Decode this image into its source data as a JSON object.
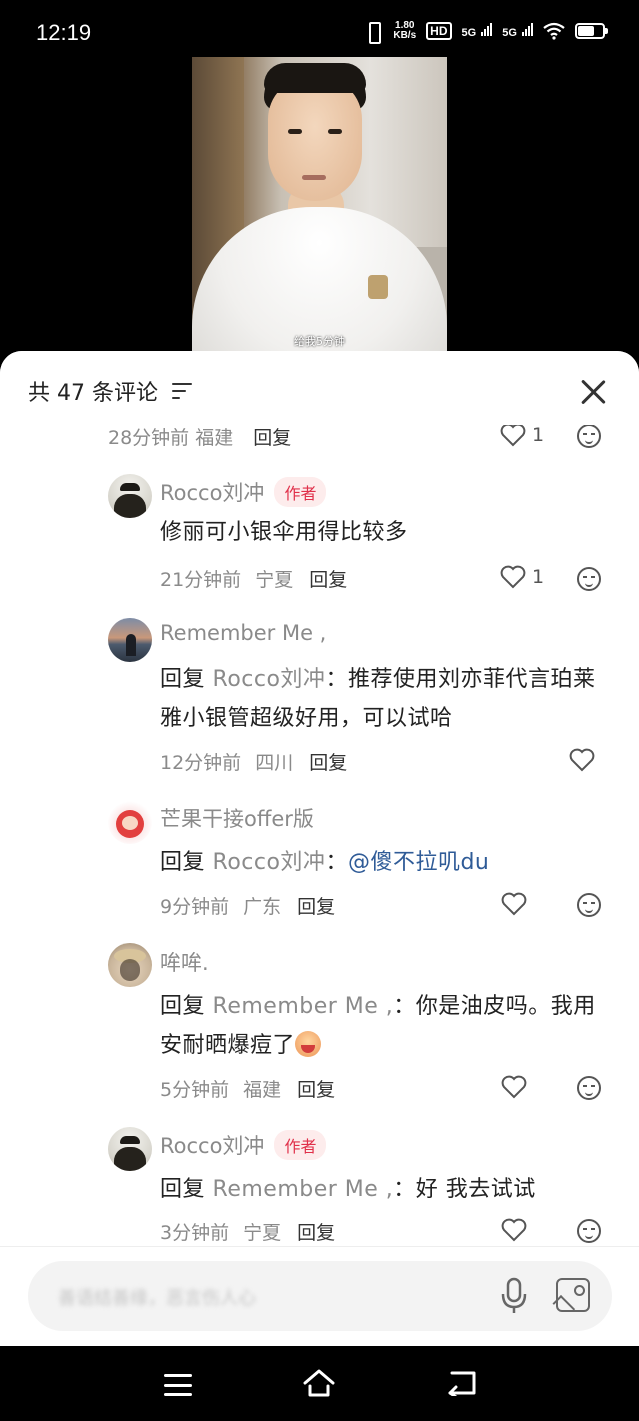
{
  "status_bar": {
    "time": "12:19",
    "net_speed_value": "1.80",
    "net_speed_unit": "KB/s",
    "hd_label": "HD",
    "signal_1": "5G",
    "signal_2": "5G"
  },
  "video": {
    "caption": "给我5分钟"
  },
  "comments_header": {
    "title": "共 47 条评论"
  },
  "partial_comment": {
    "meta": "28分钟前 福建",
    "reply_label": "回复",
    "likes": "1"
  },
  "comments": [
    {
      "avatar": "avatar-rocco",
      "name": "Rocco刘冲",
      "author_tag": "作者",
      "text": "修丽可小银伞用得比较多",
      "time": "21分钟前",
      "location": "宁夏",
      "reply_label": "回复",
      "likes": "1"
    },
    {
      "avatar": "avatar-remember-me",
      "name": "Remember Me ,",
      "reply_prefix": "回复",
      "reply_to": "Rocco刘冲",
      "text": "：推荐使用刘亦菲代言珀莱雅小银管超级好用，可以试哈",
      "time": "12分钟前",
      "location": "四川",
      "reply_label": "回复"
    },
    {
      "avatar": "avatar-mango",
      "name": "芒果干接offer版",
      "reply_prefix": "回复",
      "reply_to": "Rocco刘冲",
      "separator": "：",
      "mention": "@傻不拉叽du",
      "time": "9分钟前",
      "location": "广东",
      "reply_label": "回复"
    },
    {
      "avatar": "avatar-moumou",
      "name": "哞哞.",
      "reply_prefix": "回复",
      "reply_to": "Remember Me ,",
      "text": "：你是油皮吗。我用安耐晒爆痘了",
      "emoji": "sweat-emoji",
      "time": "5分钟前",
      "location": "福建",
      "reply_label": "回复"
    },
    {
      "avatar": "avatar-rocco",
      "name": "Rocco刘冲",
      "author_tag": "作者",
      "reply_prefix": "回复",
      "reply_to": "Remember Me ,",
      "text": "：好 我去试试",
      "time": "3分钟前",
      "location": "宁夏",
      "reply_label": "回复"
    }
  ],
  "input": {
    "placeholder": "善语结善缘，恶言伤人心"
  },
  "icons": [
    "filter-icon",
    "close-icon",
    "heart-icon",
    "emoji-icon",
    "mic-icon",
    "image-icon",
    "nav-menu-icon",
    "nav-home-icon",
    "nav-back-icon"
  ],
  "colors": {
    "author_tag_bg": "#fdecec",
    "author_tag_text": "#e0304a",
    "mention": "#2f5b97",
    "meta_text": "#8a8a8a"
  }
}
